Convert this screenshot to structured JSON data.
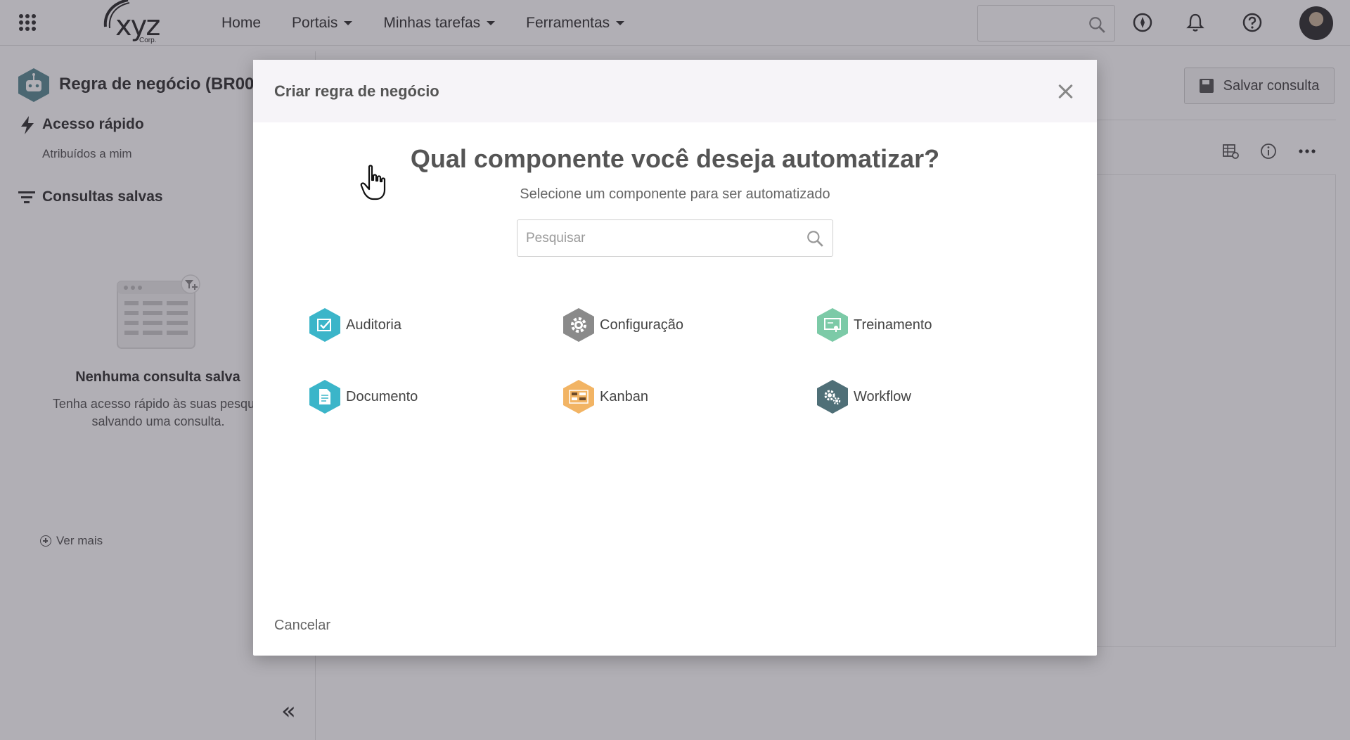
{
  "topbar": {
    "logo_text": "xyz",
    "logo_sub": "Corp.",
    "nav": [
      {
        "label": "Home",
        "dropdown": false
      },
      {
        "label": "Portais",
        "dropdown": true
      },
      {
        "label": "Minhas tarefas",
        "dropdown": true
      },
      {
        "label": "Ferramentas",
        "dropdown": true
      }
    ],
    "icons": [
      "apps-grid-icon",
      "search-icon",
      "compass-icon",
      "bell-icon",
      "help-icon",
      "avatar"
    ]
  },
  "sidebar": {
    "title": "Regra de negócio (BR00",
    "quick_access": "Acesso rápido",
    "assigned_to_me": "Atribuídos a mim",
    "saved_queries": "Consultas salvas",
    "empty_title": "Nenhuma consulta salva",
    "empty_desc_line1": "Tenha acesso rápido às suas pesquis",
    "empty_desc_line2": "salvando uma consulta.",
    "see_more": "Ver mais",
    "collapse_glyph": "«"
  },
  "main": {
    "save_query": "Salvar consulta"
  },
  "modal": {
    "title": "Criar regra de negócio",
    "question": "Qual componente você deseja automatizar?",
    "subtitle": "Selecione um componente para ser automatizado",
    "search_placeholder": "Pesquisar",
    "components": [
      {
        "label": "Auditoria",
        "icon": "audit-icon",
        "color": "#3bb5c9"
      },
      {
        "label": "Configuração",
        "icon": "gear-icon",
        "color": "#8a8a8a"
      },
      {
        "label": "Treinamento",
        "icon": "training-icon",
        "color": "#7ccaa7"
      },
      {
        "label": "Documento",
        "icon": "document-icon",
        "color": "#3bb5c9"
      },
      {
        "label": "Kanban",
        "icon": "kanban-icon",
        "color": "#f2b464"
      },
      {
        "label": "Workflow",
        "icon": "workflow-icon",
        "color": "#4f6f77"
      }
    ],
    "cancel": "Cancelar"
  },
  "colors": {
    "overlay": "#322d3c",
    "modal_header": "#f6f4f8",
    "sidebar_title_icon": "#5b8c93"
  }
}
